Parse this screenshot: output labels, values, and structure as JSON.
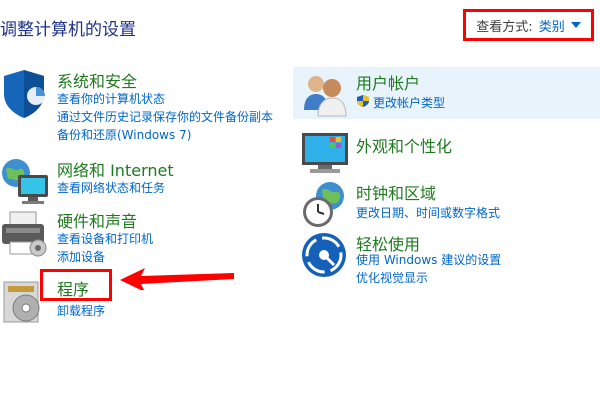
{
  "page_title": "调整计算机的设置",
  "view_by": {
    "label": "查看方式:",
    "value": "类别"
  },
  "left_categories": {
    "system_security": {
      "title": "系统和安全",
      "links": [
        "查看你的计算机状态",
        "通过文件历史记录保存你的文件备份副本",
        "备份和还原(Windows 7)"
      ]
    },
    "network": {
      "title": "网络和 Internet",
      "links": [
        "查看网络状态和任务"
      ]
    },
    "hardware": {
      "title": "硬件和声音",
      "links": [
        "查看设备和打印机",
        "添加设备"
      ]
    },
    "programs": {
      "title": "程序",
      "links": [
        "卸载程序"
      ]
    }
  },
  "right_categories": {
    "user_accounts": {
      "title": "用户帐户",
      "links": [
        "更改帐户类型"
      ]
    },
    "appearance": {
      "title": "外观和个性化",
      "links": []
    },
    "clock_region": {
      "title": "时钟和区域",
      "links": [
        "更改日期、时间或数字格式"
      ]
    },
    "ease_of_access": {
      "title": "轻松使用",
      "links": [
        "使用 Windows 建议的设置",
        "优化视觉显示"
      ]
    }
  },
  "colors": {
    "title": "#1f7a1f",
    "link": "#0066cc",
    "annotation": "#ff0000"
  }
}
